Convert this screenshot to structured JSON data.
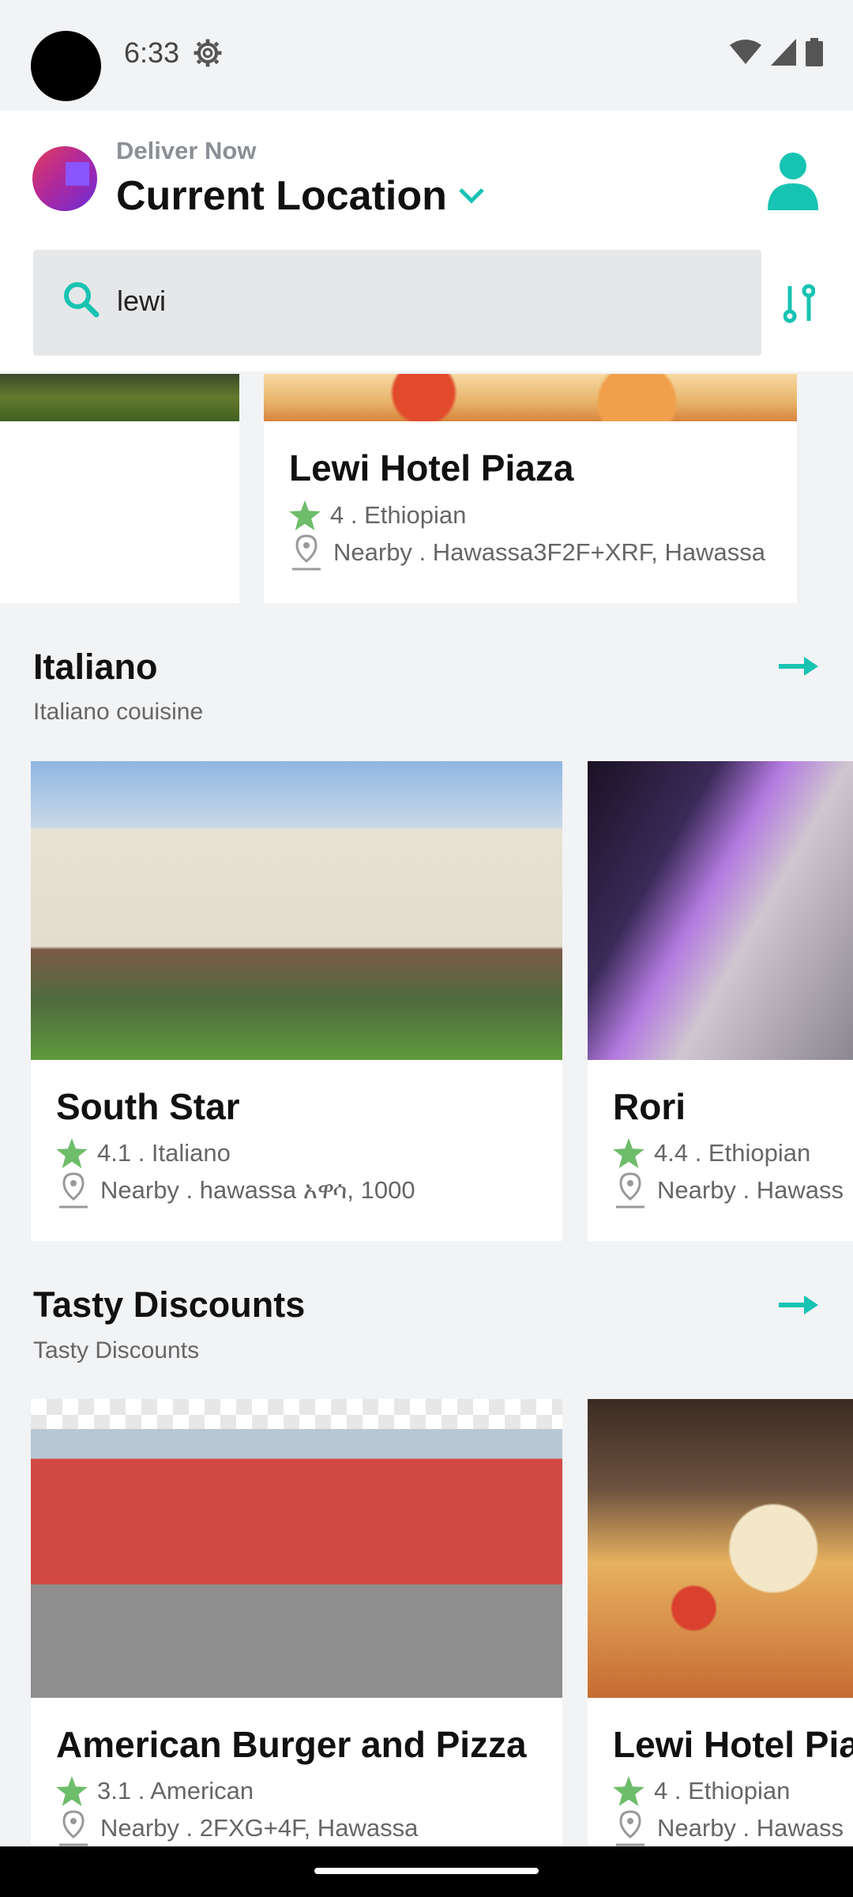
{
  "status_bar": {
    "time": "6:33"
  },
  "header": {
    "deliver_label": "Deliver Now",
    "location": "Current Location"
  },
  "search": {
    "value": "lewi"
  },
  "top_row": {
    "card": {
      "name": "Lewi Hotel Piaza",
      "rating_line": "4 . Ethiopian",
      "location_line": "Nearby . Hawassa3F2F+XRF, Hawassa"
    }
  },
  "sections": [
    {
      "title": "Italiano",
      "subtitle": "Italiano couisine",
      "cards": [
        {
          "name": "South Star",
          "rating_line": "4.1 . Italiano",
          "location_line": "Nearby . hawassa አዋሳ, 1000"
        },
        {
          "name": "Rori",
          "rating_line": "4.4 . Ethiopian",
          "location_line": "Nearby . Hawass"
        }
      ]
    },
    {
      "title": "Tasty Discounts",
      "subtitle": "Tasty Discounts",
      "cards": [
        {
          "name": "American Burger and Pizza",
          "rating_line": "3.1 . American",
          "location_line": "Nearby . 2FXG+4F, Hawassa"
        },
        {
          "name": "Lewi Hotel Pia",
          "rating_line": "4 . Ethiopian",
          "location_line": "Nearby . Hawass"
        }
      ]
    }
  ],
  "colors": {
    "accent": "#17c3b2",
    "star": "#6dbd6a",
    "muted": "#8b8f96"
  }
}
